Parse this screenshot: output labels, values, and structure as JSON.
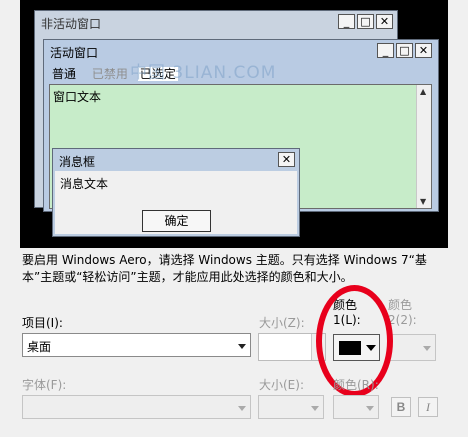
{
  "preview": {
    "inactive_window": {
      "title": "非活动窗口",
      "buttons": [
        "_",
        "□",
        "✕"
      ]
    },
    "active_window": {
      "title": "活动窗口",
      "buttons": [
        "_",
        "□",
        "✕"
      ],
      "menu": [
        "普通",
        "已禁用",
        "已选定"
      ],
      "window_text": "窗口文本"
    },
    "message_box": {
      "title": "消息框",
      "close": "✕",
      "text": "消息文本",
      "ok_button": "确定"
    },
    "watermark": "中国  3LIAN.COM"
  },
  "description": "要启用 Windows Aero，请选择 Windows 主题。只有选择 Windows 7“基本”主题或“轻松访问”主题，才能应用此处选择的颜色和大小。",
  "item": {
    "label": "项目(I):",
    "value": "桌面",
    "size_label": "大小(Z):",
    "color1_label_line1": "颜色",
    "color1_label_line2": "1(L):",
    "color2_label_line1": "颜色",
    "color2_label_line2": "2(2):"
  },
  "font": {
    "label": "字体(F):",
    "size_label": "大小(E):",
    "color_label": "颜色(R):",
    "bold": "B",
    "italic": "I"
  },
  "colors": {
    "color1_swatch": "#000000",
    "highlight_circle": "#e8001c",
    "client_bg": "#c7ecc9"
  }
}
